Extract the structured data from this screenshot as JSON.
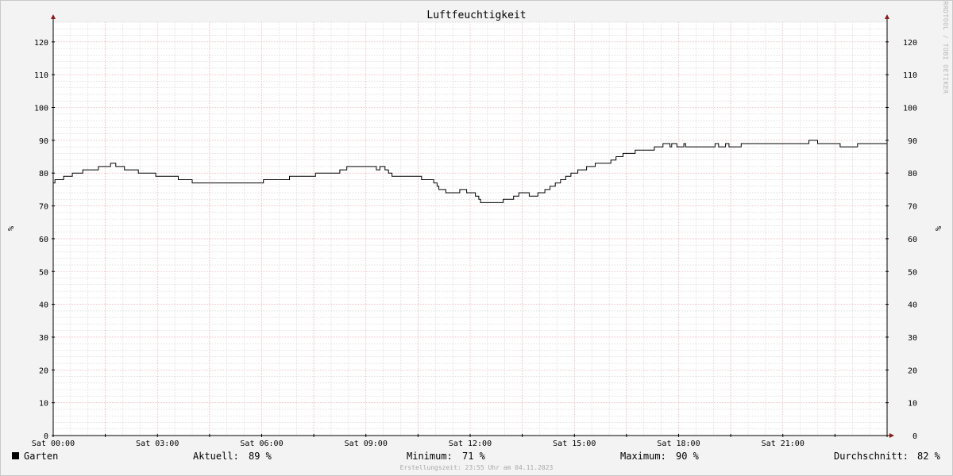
{
  "chart_data": {
    "type": "line",
    "title": "Luftfeuchtigkeit",
    "ylabel": "%",
    "ylim": [
      0,
      126
    ],
    "yticks": [
      0,
      10,
      20,
      30,
      40,
      50,
      60,
      70,
      80,
      90,
      100,
      110,
      120
    ],
    "xlim": [
      0,
      24
    ],
    "x_unit": "hours",
    "xticks": [
      {
        "x": 0,
        "label": "Sat 00:00"
      },
      {
        "x": 3,
        "label": "Sat 03:00"
      },
      {
        "x": 6,
        "label": "Sat 06:00"
      },
      {
        "x": 9,
        "label": "Sat 09:00"
      },
      {
        "x": 12,
        "label": "Sat 12:00"
      },
      {
        "x": 15,
        "label": "Sat 15:00"
      },
      {
        "x": 18,
        "label": "Sat 18:00"
      },
      {
        "x": 21,
        "label": "Sat 21:00"
      }
    ],
    "grid": true,
    "series": [
      {
        "name": "Garten",
        "color": "#000000",
        "step": true,
        "x": [
          0,
          0.05,
          0.3,
          0.55,
          0.85,
          1.3,
          1.65,
          1.8,
          2.05,
          2.45,
          2.95,
          3.05,
          3.6,
          4.0,
          6.05,
          6.8,
          7.55,
          8.25,
          8.45,
          8.55,
          9.0,
          9.3,
          9.4,
          9.55,
          9.65,
          9.75,
          10.05,
          10.6,
          10.95,
          11.05,
          11.1,
          11.3,
          11.7,
          11.9,
          12.15,
          12.25,
          12.3,
          12.95,
          13.25,
          13.4,
          13.7,
          13.95,
          14.15,
          14.3,
          14.45,
          14.6,
          14.75,
          14.9,
          15.1,
          15.35,
          15.6,
          16.05,
          16.2,
          16.4,
          16.75,
          17.3,
          17.55,
          17.6,
          17.75,
          17.8,
          17.95,
          18.05,
          18.15,
          18.2,
          18.35,
          19.05,
          19.15,
          19.35,
          19.45,
          19.8,
          21.75,
          22.0,
          22.65,
          23.15,
          24.0
        ],
        "values": [
          77,
          78,
          79,
          80,
          81,
          82,
          83,
          82,
          81,
          80,
          79,
          79,
          78,
          77,
          78,
          79,
          80,
          81,
          82,
          82,
          82,
          81,
          82,
          81,
          80,
          79,
          79,
          78,
          77,
          76,
          75,
          74,
          75,
          74,
          73,
          72,
          71,
          72,
          73,
          74,
          73,
          74,
          75,
          76,
          77,
          78,
          79,
          80,
          81,
          82,
          83,
          84,
          85,
          86,
          87,
          88,
          89,
          89,
          88,
          89,
          88,
          88,
          89,
          88,
          88,
          89,
          88,
          89,
          88,
          89,
          90,
          89,
          88,
          89,
          89
        ]
      }
    ]
  },
  "legend": {
    "series_name": "Garten",
    "current_label": "Aktuell:",
    "current_value": "89 %",
    "min_label": "Minimum:",
    "min_value": "71 %",
    "max_label": "Maximum:",
    "max_value": "90 %",
    "avg_label": "Durchschnitt:",
    "avg_value": "82 %"
  },
  "watermark": "RRDTOOL / TOBI OETIKER",
  "created": "Erstellungszeit: 23:55 Uhr am 04.11.2023",
  "colors": {
    "background": "#f3f3f3",
    "plot_background": "#ffffff",
    "major_grid": "#e6a0a8",
    "minor_grid": "#c8c8c8",
    "axis": "#000000",
    "arrow": "#8b1a1a",
    "line": "#000000"
  }
}
